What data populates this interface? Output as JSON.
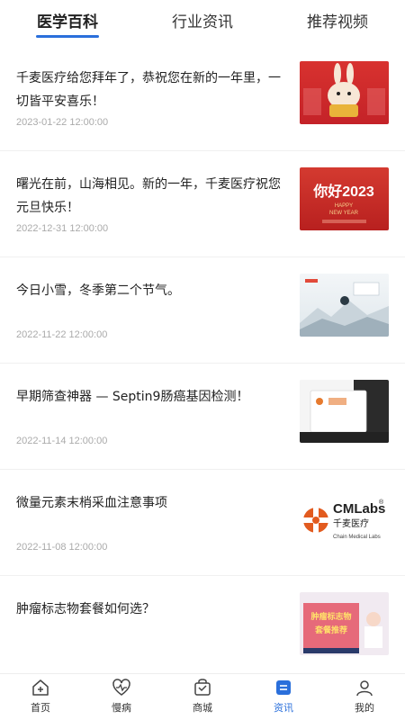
{
  "tabs": [
    {
      "label": "医学百科",
      "active": true
    },
    {
      "label": "行业资讯",
      "active": false
    },
    {
      "label": "推荐视频",
      "active": false
    }
  ],
  "accent_color": "#2a6fdb",
  "articles": [
    {
      "title": "千麦医疗给您拜年了，恭祝您在新的一年里，一切皆平安喜乐！",
      "date": "2023-01-22 12:00:00",
      "thumb": "new-year-rabbit-image"
    },
    {
      "title": "曙光在前，山海相见。新的一年，千麦医疗祝您元旦快乐！",
      "date": "2022-12-31 12:00:00",
      "thumb": "hello-2023-image",
      "thumb_text": {
        "main": "你好2023",
        "sub1": "HAPPY",
        "sub2": "NEW YEAR"
      }
    },
    {
      "title": "今日小雪，冬季第二个节气。",
      "date": "2022-11-22 12:00:00",
      "thumb": "light-snow-image"
    },
    {
      "title": "早期筛查神器 — Septin9肠癌基因检测！",
      "date": "2022-11-14 12:00:00",
      "thumb": "septin9-kit-image"
    },
    {
      "title": "微量元素末梢采血注意事项",
      "date": "2022-11-08 12:00:00",
      "thumb": "cmlabs-logo-image",
      "thumb_text": {
        "brand": "CMLabs",
        "reg": "®",
        "cn": "千麦医疗",
        "en": "Chain Medical Labs"
      }
    },
    {
      "title": "肿瘤标志物套餐如何选？",
      "date": "",
      "thumb": "tumor-marker-image",
      "thumb_text": {
        "l1": "肿瘤标志物",
        "l2": "套餐推荐"
      }
    }
  ],
  "tabbar": [
    {
      "label": "首页",
      "icon": "home-icon",
      "active": false
    },
    {
      "label": "慢病",
      "icon": "chronic-disease-icon",
      "active": false
    },
    {
      "label": "商城",
      "icon": "shop-bag-icon",
      "active": false
    },
    {
      "label": "资讯",
      "icon": "news-icon",
      "active": true
    },
    {
      "label": "我的",
      "icon": "profile-icon",
      "active": false
    }
  ]
}
